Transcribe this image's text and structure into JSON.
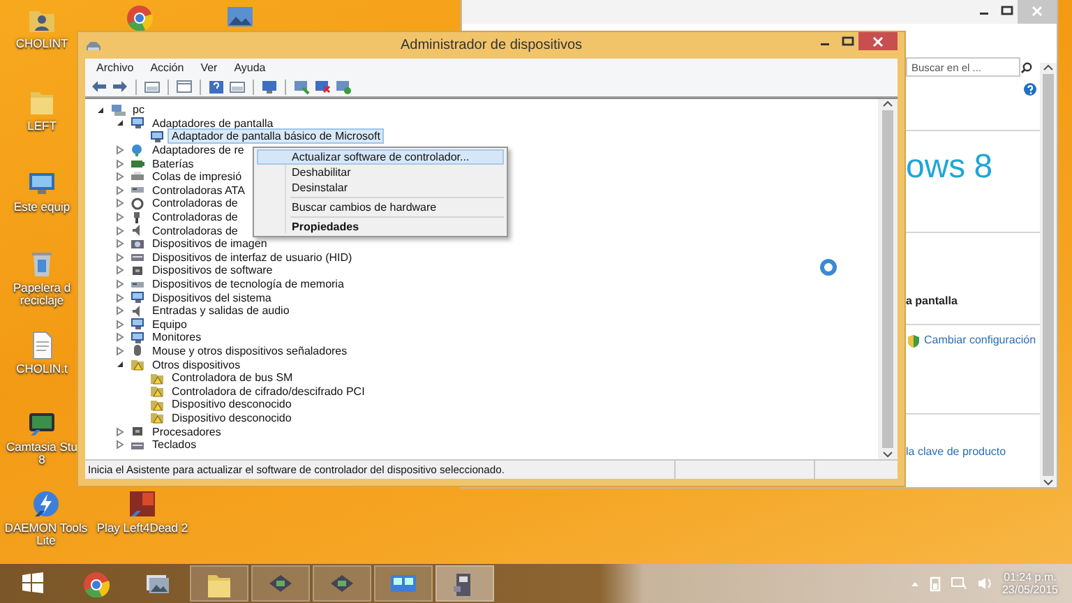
{
  "desktop": {
    "icons": [
      {
        "kind": "user-folder",
        "label": "CHOLINT"
      },
      {
        "kind": "browser"
      },
      {
        "kind": "photo"
      },
      {
        "kind": "folder",
        "label": "LEFT"
      },
      {
        "kind": "computer",
        "label": "Este equip"
      },
      {
        "kind": "recycle-bin",
        "label": "Papelera d reciclaje"
      },
      {
        "kind": "text-file",
        "label": "CHOLIN.t"
      },
      {
        "kind": "camtasia",
        "label": "Camtasia Stu 8"
      },
      {
        "kind": "daemon",
        "label": "DAEMON Tools Lite"
      },
      {
        "kind": "game",
        "label": "Play Left4Dead 2"
      }
    ]
  },
  "system_window": {
    "search": {
      "placeholder": "Buscar en el ..."
    },
    "logo": {
      "name": "ows",
      "version": "8"
    },
    "heading": "a pantalla",
    "links": [
      {
        "kind": "shield",
        "label": "Cambiar configuración"
      },
      {
        "kind": "plain",
        "label": "la clave de producto"
      }
    ]
  },
  "device_manager": {
    "title": "Administrador de dispositivos",
    "menu": [
      "Archivo",
      "Acción",
      "Ver",
      "Ayuda"
    ],
    "tree": [
      {
        "kind": "computer",
        "label": "pc",
        "expanded": true,
        "selected": false,
        "children": [
          {
            "kind": "display",
            "label": "Adaptadores de pantalla",
            "expanded": true,
            "selected": false,
            "children": [
              {
                "kind": "display",
                "label": "Adaptador de pantalla básico de Microsoft",
                "selected": true
              }
            ]
          },
          {
            "kind": "network",
            "label": "Adaptadores de re",
            "expanded": false,
            "selected": false
          },
          {
            "kind": "battery",
            "label": "Baterías",
            "expanded": false,
            "selected": false
          },
          {
            "kind": "printer",
            "label": "Colas de impresió",
            "expanded": false,
            "selected": false
          },
          {
            "kind": "drive",
            "label": "Controladoras ATA",
            "expanded": false,
            "selected": false
          },
          {
            "kind": "gear",
            "label": "Controladoras de",
            "expanded": false,
            "selected": false
          },
          {
            "kind": "usb",
            "label": "Controladoras de",
            "expanded": false,
            "selected": false
          },
          {
            "kind": "speaker",
            "label": "Controladoras de",
            "expanded": false,
            "selected": false
          },
          {
            "kind": "camera",
            "label": "Dispositivos de imagen",
            "expanded": false,
            "selected": false
          },
          {
            "kind": "keyboard",
            "label": "Dispositivos de interfaz de usuario (HID)",
            "expanded": false,
            "selected": false
          },
          {
            "kind": "chip",
            "label": "Dispositivos de software",
            "expanded": false,
            "selected": false
          },
          {
            "kind": "drive",
            "label": "Dispositivos de tecnología de memoria",
            "expanded": false,
            "selected": false
          },
          {
            "kind": "display",
            "label": "Dispositivos del sistema",
            "expanded": false,
            "selected": false
          },
          {
            "kind": "speaker",
            "label": "Entradas y salidas de audio",
            "expanded": false,
            "selected": false
          },
          {
            "kind": "display",
            "label": "Equipo",
            "expanded": false,
            "selected": false
          },
          {
            "kind": "display",
            "label": "Monitores",
            "expanded": false,
            "selected": false
          },
          {
            "kind": "mouse",
            "label": "Mouse y otros dispositivos señaladores",
            "expanded": false,
            "selected": false
          },
          {
            "kind": "unknown",
            "label": "Otros dispositivos",
            "expanded": true,
            "selected": false,
            "children": [
              {
                "kind": "unknown",
                "label": "Controladora de bus SM",
                "selected": false
              },
              {
                "kind": "unknown",
                "label": "Controladora de cifrado/descifrado PCI",
                "selected": false
              },
              {
                "kind": "unknown",
                "label": "Dispositivo desconocido",
                "selected": false
              },
              {
                "kind": "unknown",
                "label": "Dispositivo desconocido",
                "selected": false
              }
            ]
          },
          {
            "kind": "chip",
            "label": "Procesadores",
            "expanded": false,
            "selected": false
          },
          {
            "kind": "keyboard",
            "label": "Teclados",
            "expanded": false,
            "selected": false
          }
        ]
      }
    ],
    "context_menu": [
      {
        "kind": "item",
        "label": "Actualizar software de controlador...",
        "selected": true,
        "separator_before": false
      },
      {
        "kind": "item",
        "label": "Deshabilitar",
        "selected": false,
        "separator_before": false
      },
      {
        "kind": "item",
        "label": "Desinstalar",
        "selected": false,
        "separator_before": false
      },
      {
        "kind": "item",
        "label": "Buscar cambios de hardware",
        "selected": false,
        "separator_before": true
      },
      {
        "kind": "default",
        "label": "Propiedades",
        "selected": false,
        "separator_before": true
      }
    ],
    "status_bar": "Inicia el Asistente para actualizar el software de controlador del dispositivo seleccionado."
  },
  "taskbar": {
    "buttons": [
      {
        "kind": "start",
        "open": false,
        "selected": false
      },
      {
        "kind": "browser",
        "open": false,
        "selected": false
      },
      {
        "kind": "photos",
        "open": false,
        "selected": false
      },
      {
        "kind": "explorer",
        "open": true,
        "selected": false
      },
      {
        "kind": "chip",
        "open": true,
        "selected": false
      },
      {
        "kind": "chip",
        "open": true,
        "selected": false
      },
      {
        "kind": "remote",
        "open": true,
        "selected": false
      },
      {
        "kind": "device",
        "open": true,
        "selected": true
      }
    ],
    "clock": {
      "time": "01:24 p.m.",
      "date": "23/05/2015"
    }
  }
}
